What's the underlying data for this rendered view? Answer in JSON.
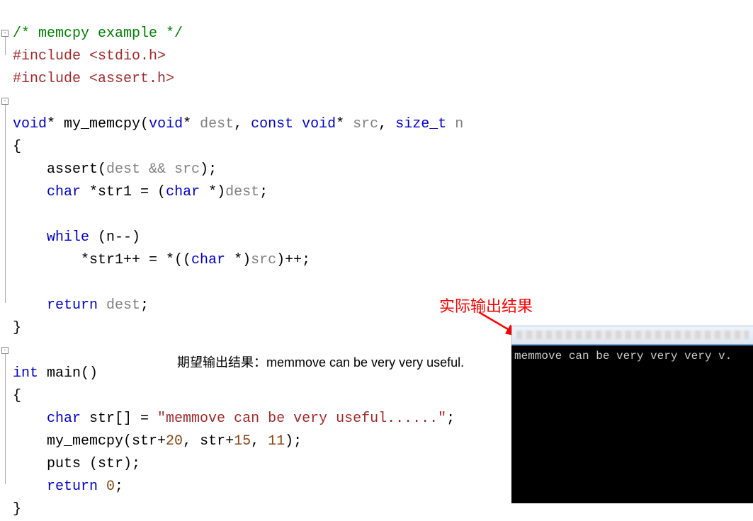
{
  "code": {
    "l1_comment": "/* memcpy example */",
    "l2_pp": "#include ",
    "l2_hdr": "<stdio.h>",
    "l3_pp": "#include ",
    "l3_hdr": "<assert.h>",
    "l5_void": "void",
    "l5_star": "*",
    "l5_fn": " my_memcpy(",
    "l5_void2": "void",
    "l5_star2": "*",
    "l5_dest": " dest",
    "l5_comma1": ", ",
    "l5_const": "const void",
    "l5_star3": "*",
    "l5_src": " src",
    "l5_comma2": ", ",
    "l5_sizet": "size_t",
    "l5_n": " n",
    "l6_brace": "{",
    "l7_assert": "    assert(",
    "l7_args": "dest && src",
    "l7_end": ");",
    "l8_char": "    char ",
    "l8_str1": "*str1 = (",
    "l8_char2": "char ",
    "l8_paren": "*)",
    "l8_dest": "dest",
    "l8_semi": ";",
    "l10_while": "    while ",
    "l10_cond": "(n--)",
    "l11_pre": "        *str1++ = *((",
    "l11_char": "char ",
    "l11_star": "*)",
    "l11_src": "src",
    "l11_post": ")++;",
    "l13_return": "    return ",
    "l13_dest": "dest",
    "l13_semi": ";",
    "l14_brace": "}",
    "l16_int": "int",
    "l16_main": " main()",
    "l17_brace": "{",
    "l18_char": "    char ",
    "l18_str": "str[] = ",
    "l18_lit": "\"memmove can be very useful......\"",
    "l18_semi": ";",
    "l19_a": "    my_memcpy(str+",
    "l19_n1": "20",
    "l19_b": ", str+",
    "l19_n2": "15",
    "l19_c": ", ",
    "l19_n3": "11",
    "l19_d": ");",
    "l20": "    puts (str);",
    "l21_return": "    return ",
    "l21_zero": "0",
    "l21_semi": ";",
    "l22_brace": "}"
  },
  "annotations": {
    "expected_label": "期望输出结果：",
    "expected_value": "memmove can be very very useful.",
    "actual_label": "实际输出结果"
  },
  "console": {
    "output": "memmove can be very very very v."
  }
}
